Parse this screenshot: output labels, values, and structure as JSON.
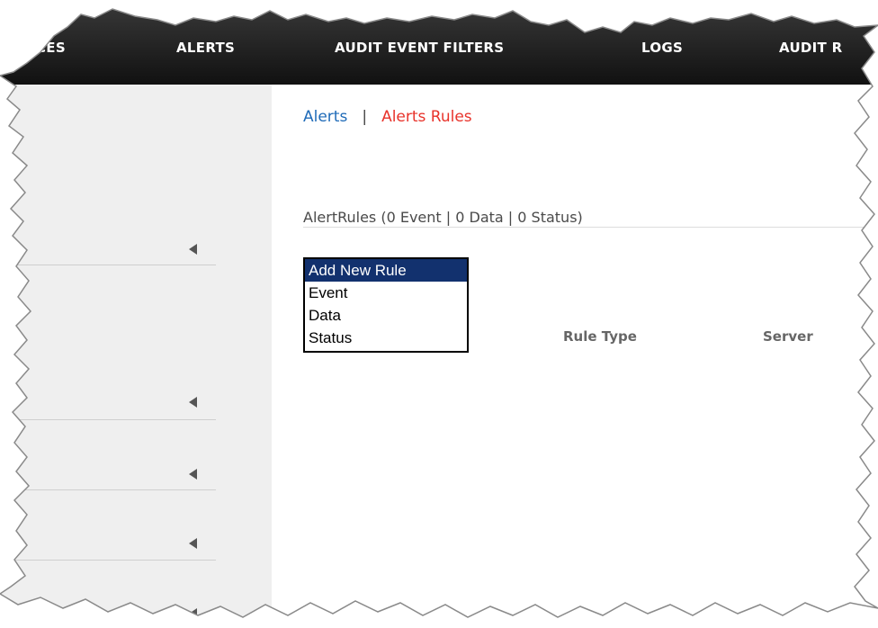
{
  "nav": {
    "items": [
      "CES",
      "ALERTS",
      "AUDIT EVENT FILTERS",
      "LOGS",
      "AUDIT R"
    ]
  },
  "main": {
    "links": {
      "alerts": "Alerts",
      "separator": "|",
      "alerts_rules": "Alerts Rules"
    },
    "summary": "AlertRules (0 Event | 0 Data | 0 Status)",
    "add_rule_list": {
      "options": [
        "Add New Rule",
        "Event",
        "Data",
        "Status"
      ],
      "selected": "Add New Rule"
    },
    "columns": [
      "Rule Type",
      "Server"
    ]
  },
  "colors": {
    "nav_bg": "#1a1a1a",
    "link_blue": "#1f6bb8",
    "link_red": "#e8332b",
    "selected_option": "#12316e",
    "sidebar_bg": "#efefef"
  }
}
